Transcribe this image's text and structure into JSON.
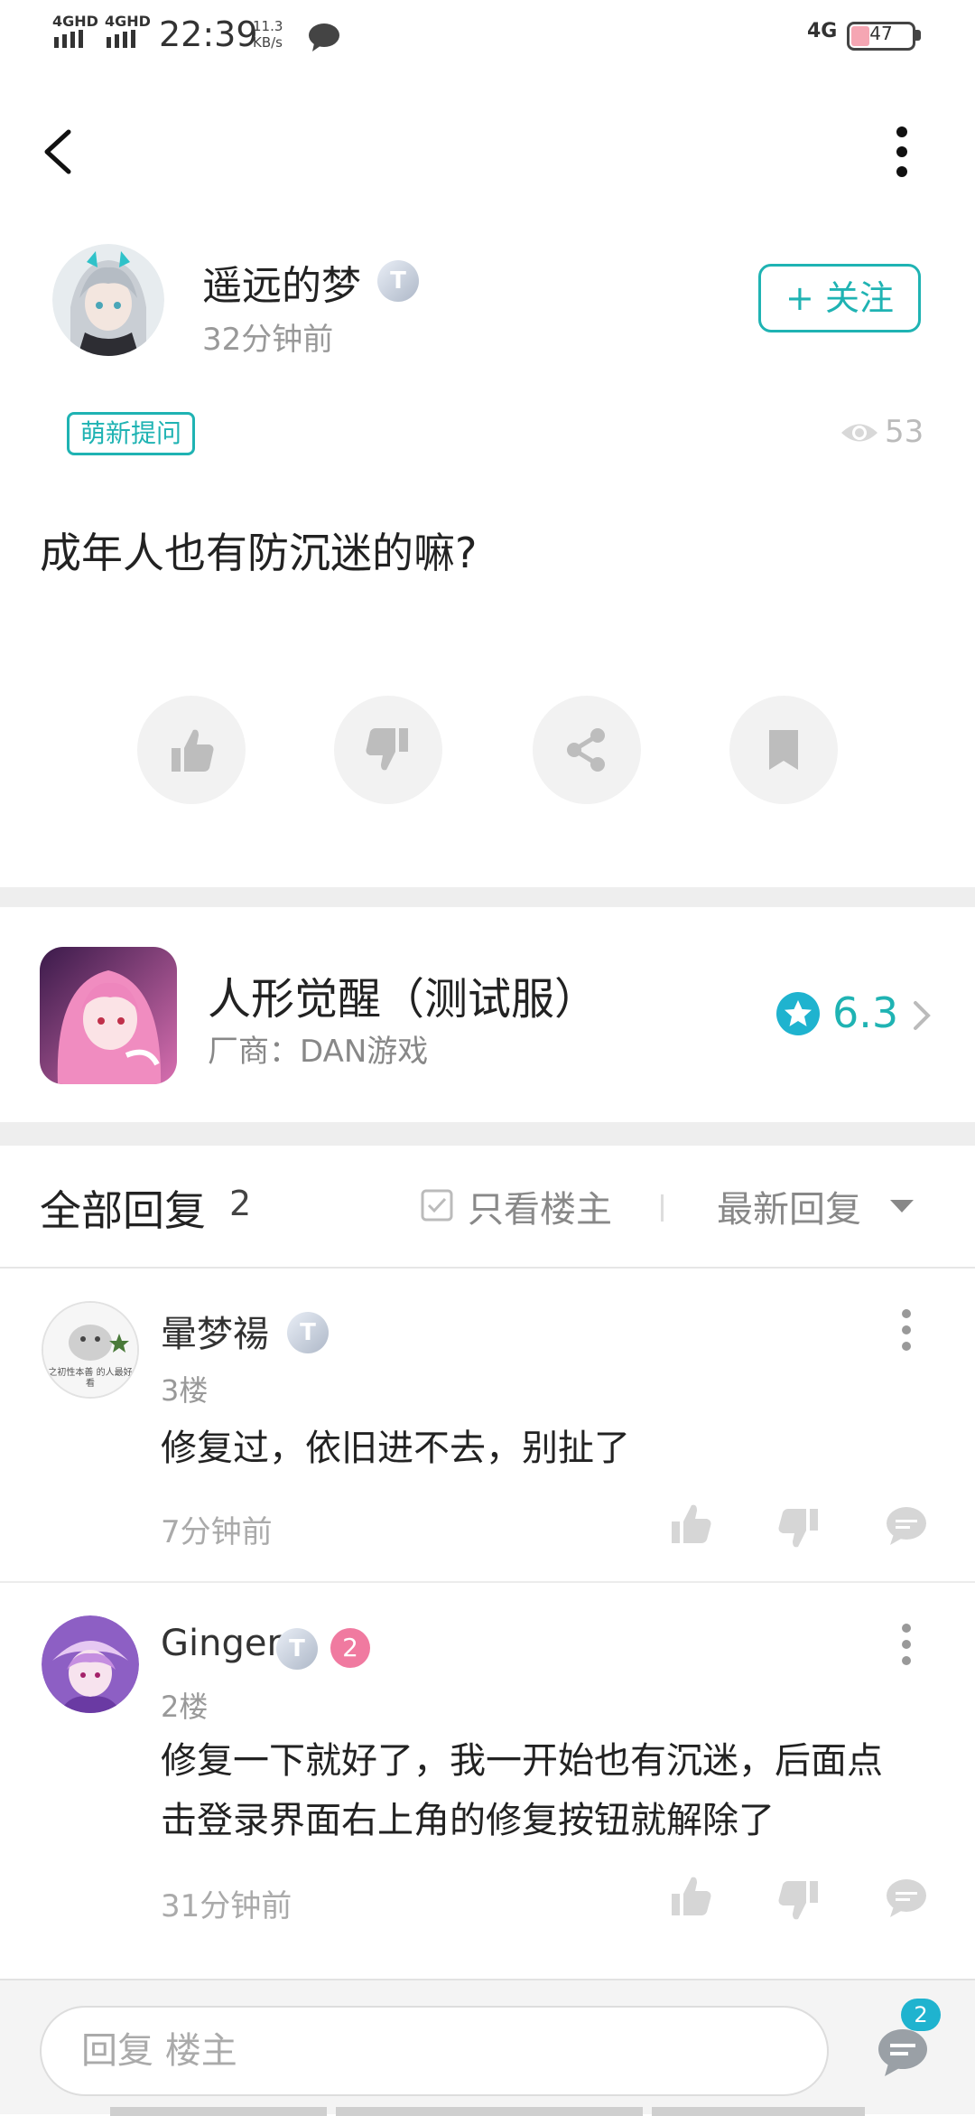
{
  "status_bar": {
    "signal1": "4GHD",
    "signal2": "4GHD",
    "time": "22:39",
    "speed_value": "11.3",
    "speed_unit": "KB/s",
    "network": "4G",
    "battery": "47"
  },
  "post": {
    "author": "遥远的梦",
    "author_badge": "T",
    "time": "32分钟前",
    "follow_label": "+ 关注",
    "tag": "萌新提问",
    "views": "53",
    "content": "成年人也有防沉迷的嘛?"
  },
  "game": {
    "name": "人形觉醒（测试服）",
    "vendor": "厂商：DAN游戏",
    "rating": "6.3"
  },
  "replies_header": {
    "title": "全部回复",
    "count": "2",
    "only_op_label": "只看楼主",
    "sort_label": "最新回复"
  },
  "comments": [
    {
      "name": "暈梦禓",
      "badge": "T",
      "floor": "3楼",
      "text": "修复过，依旧进不去，别扯了",
      "time": "7分钟前",
      "avatar_text": "之初性本善 的人最好看"
    },
    {
      "name": "Ginger",
      "badge": "T",
      "level": "2",
      "floor": "2楼",
      "text_line1": "修复一下就好了，我一开始也有沉迷，后面点",
      "text_line2": "击登录界面右上角的修复按钮就解除了",
      "time": "31分钟前"
    }
  ],
  "bottom_bar": {
    "reply_placeholder": "回复  楼主",
    "comment_count": "2"
  },
  "colors": {
    "accent": "#1fb3b3",
    "divider": "#eeeeee"
  }
}
